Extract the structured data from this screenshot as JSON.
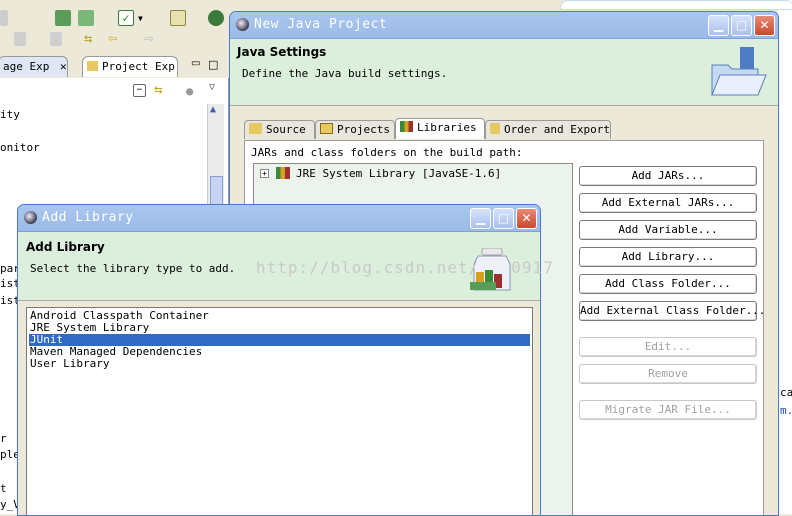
{
  "ide": {
    "tabs": [
      "age Exp",
      "Project Exp"
    ],
    "panel_rows": [
      "ity",
      "onitor",
      "par",
      "ist",
      "ist",
      "r",
      "ple",
      "t",
      "y_V"
    ],
    "right_partial": [
      "ca",
      "m."
    ]
  },
  "new_java_project": {
    "title": "New Java Project",
    "header_title": "Java Settings",
    "header_desc": "Define the Java build settings.",
    "tabs": [
      {
        "label": "Source",
        "icon": "source-folder-icon"
      },
      {
        "label": "Projects",
        "icon": "projects-folder-icon"
      },
      {
        "label": "Libraries",
        "icon": "libraries-books-icon"
      },
      {
        "label": "Order and Export",
        "icon": "order-export-icon"
      }
    ],
    "active_tab": "Libraries",
    "build_path_label": "JARs and class folders on the build path:",
    "tree_items": [
      "JRE System Library [JavaSE-1.6]"
    ],
    "buttons": [
      {
        "label": "Add JARs...",
        "enabled": true
      },
      {
        "label": "Add External JARs...",
        "enabled": true
      },
      {
        "label": "Add Variable...",
        "enabled": true
      },
      {
        "label": "Add Library...",
        "enabled": true
      },
      {
        "label": "Add Class Folder...",
        "enabled": true
      },
      {
        "label": "Add External Class Folder...",
        "enabled": true
      },
      {
        "label": "Edit...",
        "enabled": false
      },
      {
        "label": "Remove",
        "enabled": false
      },
      {
        "label": "Migrate JAR File...",
        "enabled": false
      }
    ]
  },
  "add_library": {
    "title": "Add Library",
    "header_title": "Add Library",
    "header_desc": "Select the library type to add.",
    "items": [
      "Android Classpath Container",
      "JRE System Library",
      "JUnit",
      "Maven Managed Dependencies",
      "User Library"
    ],
    "selected_index": 2
  },
  "watermark": "http://blog.csdn.net/",
  "watermark_tail": "0917",
  "colors": {
    "titlebar": "#9bbbe8",
    "header_bg": "#dcefdc",
    "selection": "#316ac5",
    "dialog_bg": "#ece9d8"
  }
}
